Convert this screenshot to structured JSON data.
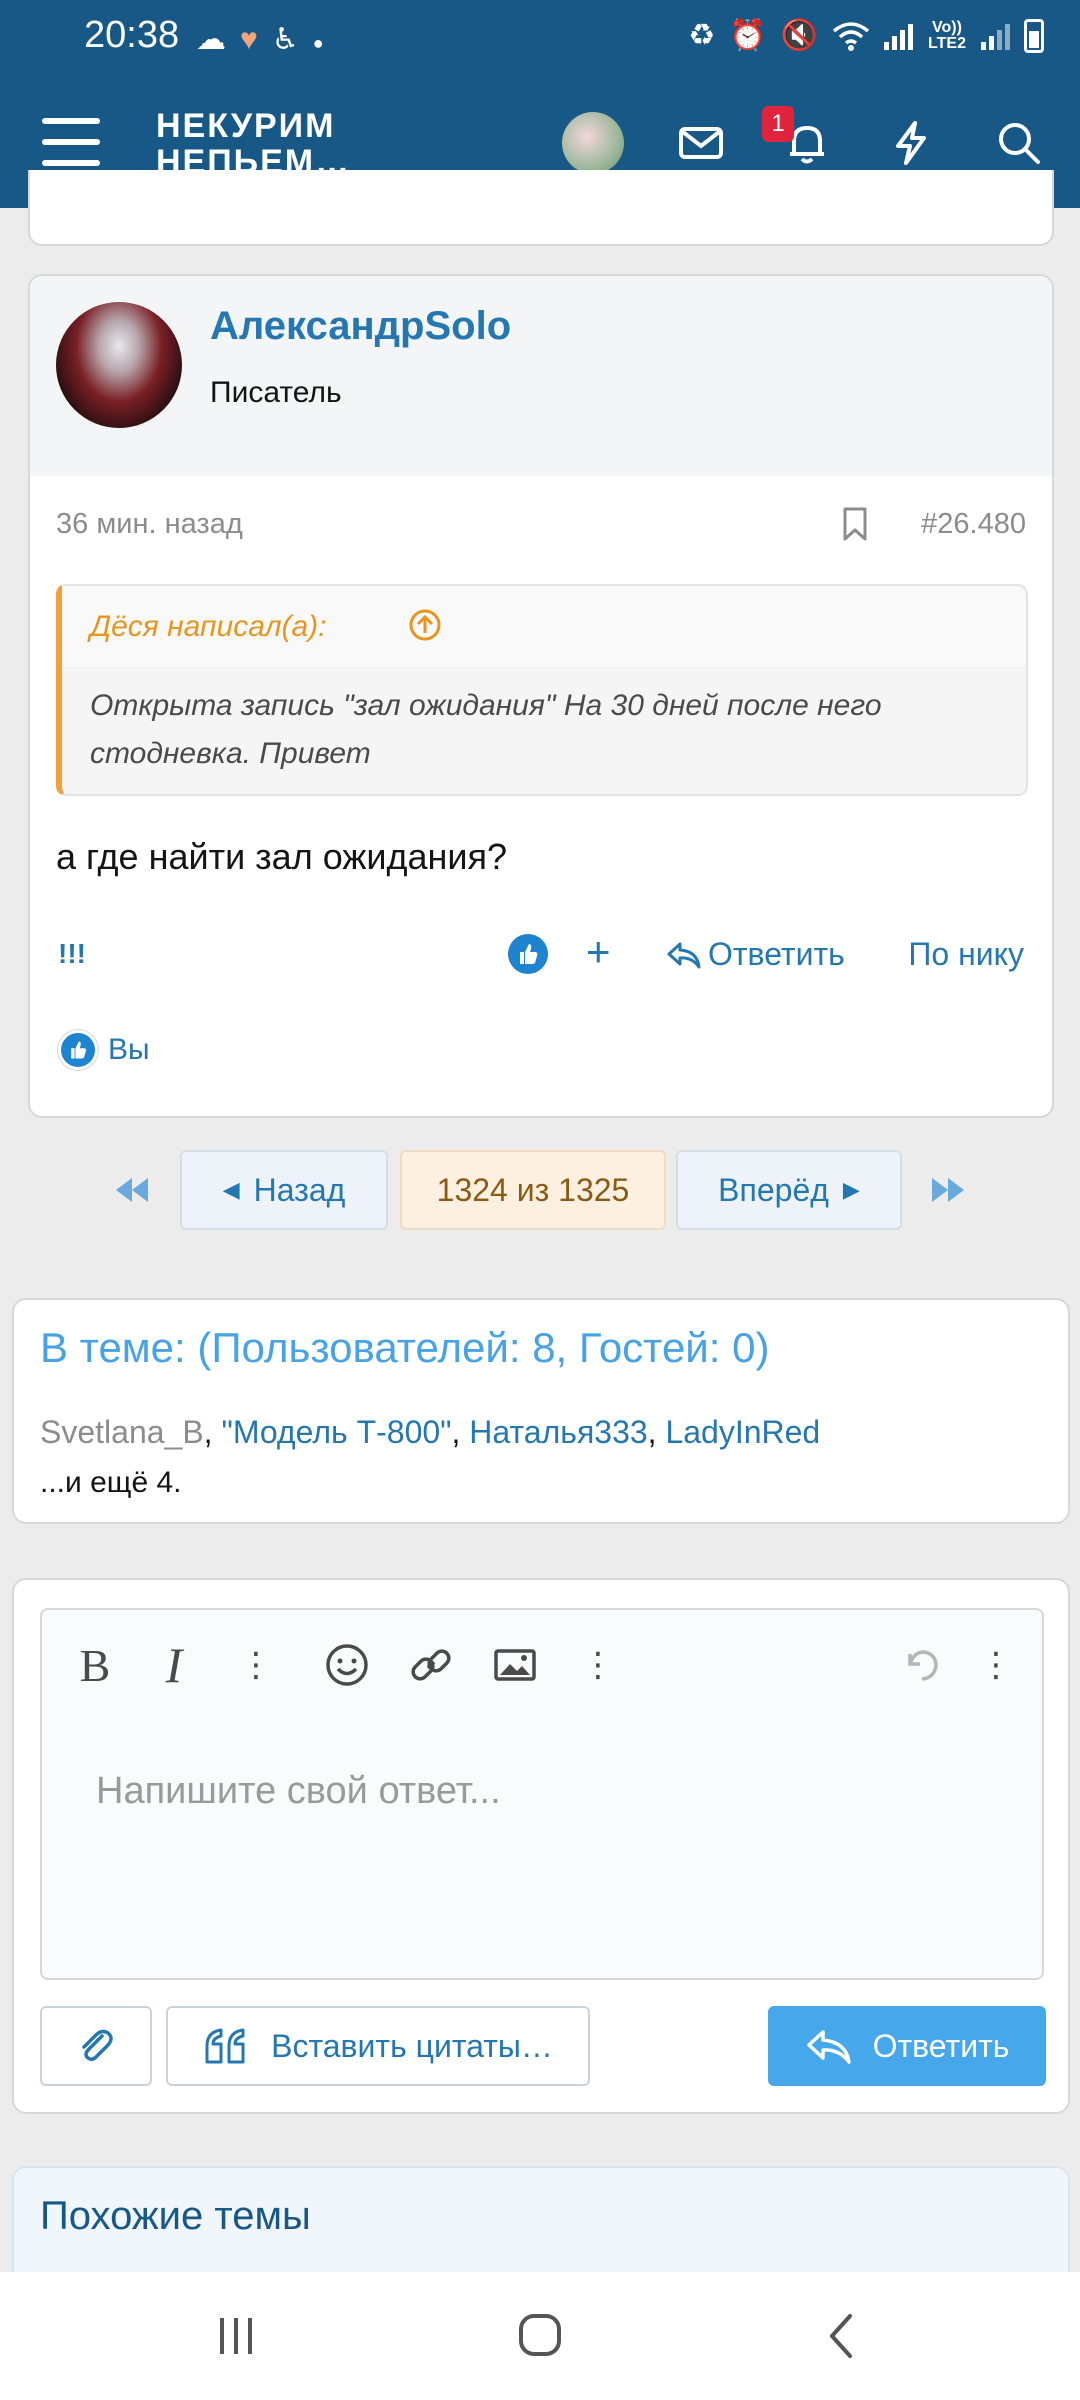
{
  "status": {
    "time": "20:38",
    "left_icons": [
      "cloud-icon",
      "heart-icon",
      "accessibility-icon",
      "dot-icon"
    ],
    "right_icons": [
      "recycle-icon",
      "alarm-icon",
      "mute-icon",
      "wifi-icon",
      "signal-icon",
      "signal-icon",
      "battery-icon"
    ],
    "lte_label": "Vo)) LTE2"
  },
  "header": {
    "logo_line1": "НЕКУРИМ",
    "logo_line2": "НЕПЬЕМ…",
    "notification_count": "1"
  },
  "post": {
    "author": "АлександрSolo",
    "role": "Писатель",
    "time": "36 мин. назад",
    "number": "#26.480",
    "quote_author": "Дёся написал(а):",
    "quote_text": "Открыта запись \"зал ожидания\" На 30 дней после него стодневка. Привет",
    "body": "а где найти зал ожидания?",
    "action_excl": "!!!",
    "action_plus": "+",
    "action_reply": "Ответить",
    "action_nick": "По нику",
    "reaction_user": "Вы"
  },
  "pagination": {
    "prev": "Назад",
    "current": "1324 из 1325",
    "next": "Вперёд"
  },
  "online": {
    "title": "В теме: (Пользователей: 8, Гостей: 0)",
    "users": [
      "Svetlana_B",
      "\"Модель Т-800\"",
      "Наталья333",
      "LadyInRed"
    ],
    "separator": ", ",
    "more": "...и ещё 4."
  },
  "editor": {
    "placeholder": "Напишите свой ответ...",
    "bold": "B",
    "italic": "I",
    "insert_quotes": "Вставить цитаты…",
    "reply": "Ответить"
  },
  "similar": {
    "title": "Похожие темы"
  },
  "colors": {
    "header_bg": "#185886",
    "link": "#2577b1",
    "quote_accent": "#f0a13c",
    "primary_button": "#47a7eb",
    "badge": "#e0243b"
  }
}
